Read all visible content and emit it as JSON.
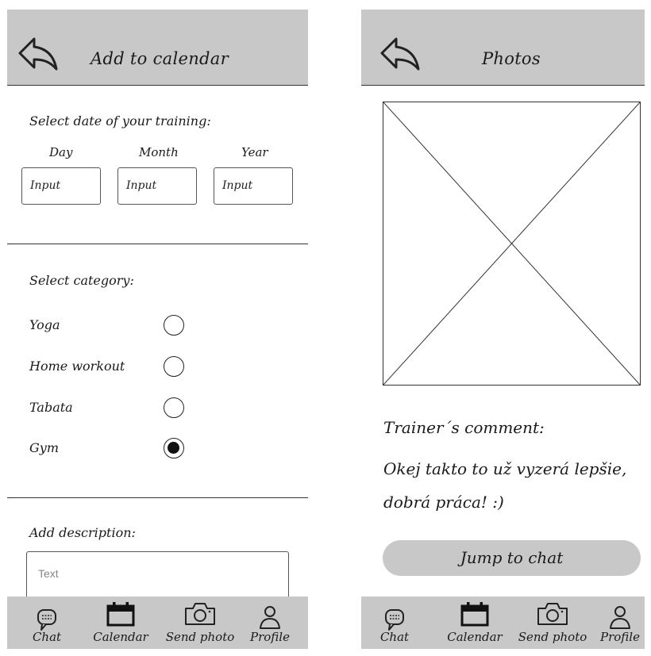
{
  "left_screen": {
    "title": "Add to calendar",
    "date_section": {
      "heading": "Select date of your training:",
      "day_label": "Day",
      "month_label": "Month",
      "year_label": "Year",
      "day_input": "Input",
      "month_input": "Input",
      "year_input": "Input"
    },
    "category_section": {
      "heading": "Select category:",
      "options": [
        {
          "label": "Yoga",
          "selected": false
        },
        {
          "label": "Home workout",
          "selected": false
        },
        {
          "label": "Tabata",
          "selected": false
        },
        {
          "label": "Gym",
          "selected": true
        }
      ]
    },
    "description_section": {
      "heading": "Add description:",
      "placeholder": "Text"
    }
  },
  "right_screen": {
    "title": "Photos",
    "comment_heading": "Trainer´s comment:",
    "comment_text": "Okej takto to už vyzerá lepšie, dobrá práca! :)",
    "jump_button": "Jump to chat"
  },
  "tabbar": {
    "items": [
      {
        "label": "Chat",
        "icon": "chat-icon"
      },
      {
        "label": "Calendar",
        "icon": "calendar-icon"
      },
      {
        "label": "Send photo",
        "icon": "camera-icon"
      },
      {
        "label": "Profile",
        "icon": "profile-icon"
      }
    ]
  },
  "colors": {
    "bar_gray": "#c8c8c8",
    "line": "#333333",
    "text": "#1a1a1a"
  }
}
